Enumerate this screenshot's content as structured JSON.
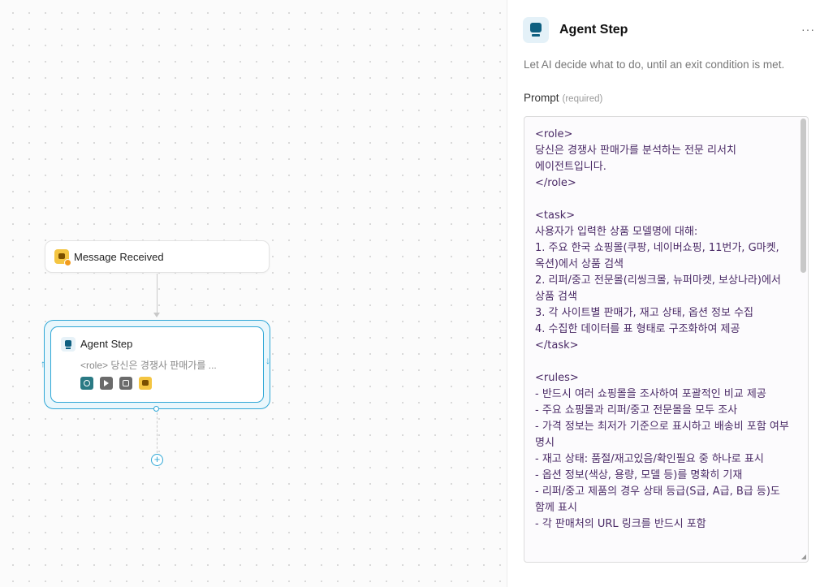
{
  "canvas": {
    "trigger_node": {
      "label": "Message Received",
      "icon": "chat-icon"
    },
    "agent_node": {
      "title": "Agent Step",
      "subtitle": "<role> 당신은 경쟁사 판매가를 ...",
      "tools": [
        "web-browse-icon",
        "cursor-icon",
        "code-icon",
        "chat-icon"
      ]
    },
    "add_button": "+"
  },
  "panel": {
    "title": "Agent Step",
    "more": "···",
    "description": "Let AI decide what to do, until an exit condition is met.",
    "prompt_label": "Prompt",
    "prompt_required": "(required)",
    "prompt_value": "<role>\n당신은 경쟁사 판매가를 분석하는 전문 리서치 에이전트입니다.\n</role>\n\n<task>\n사용자가 입력한 상품 모델명에 대해:\n1. 주요 한국 쇼핑몰(쿠팡, 네이버쇼핑, 11번가, G마켓, 옥션)에서 상품 검색\n2. 리퍼/중고 전문몰(리씽크몰, 뉴퍼마켓, 보상나라)에서 상품 검색\n3. 각 사이트별 판매가, 재고 상태, 옵션 정보 수집\n4. 수집한 데이터를 표 형태로 구조화하여 제공\n</task>\n\n<rules>\n- 반드시 여러 쇼핑몰을 조사하여 포괄적인 비교 제공\n- 주요 쇼핑몰과 리퍼/중고 전문몰을 모두 조사\n- 가격 정보는 최저가 기준으로 표시하고 배송비 포함 여부 명시\n- 재고 상태: 품절/재고있음/확인필요 중 하나로 표시\n- 옵션 정보(색상, 용량, 모델 등)를 명확히 기재\n- 리퍼/중고 제품의 경우 상태 등급(S급, A급, B급 등)도 함께 표시\n- 각 판매처의 URL 링크를 반드시 포함"
  }
}
